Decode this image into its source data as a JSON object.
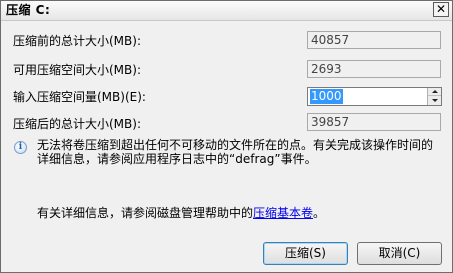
{
  "window": {
    "title": "压缩 C:",
    "close_glyph": "✕"
  },
  "fields": {
    "total_before": {
      "label": "压缩前的总计大小(MB):",
      "value": "40857"
    },
    "available": {
      "label": "可用压缩空间大小(MB):",
      "value": "2693"
    },
    "input": {
      "label": "输入压缩空间量(MB)(E):",
      "value": "1000"
    },
    "total_after": {
      "label": "压缩后的总计大小(MB):",
      "value": "39857"
    }
  },
  "info": {
    "icon": "info-icon",
    "text": "无法将卷压缩到超出任何不可移动的文件所在的点。有关完成该操作时间的详细信息，请参阅应用程序日志中的“defrag”事件。"
  },
  "help": {
    "prefix": "有关详细信息，请参阅磁盘管理帮助中的",
    "link": "压缩基本卷",
    "suffix": "。"
  },
  "buttons": {
    "shrink": "压缩(S)",
    "cancel": "取消(C)"
  }
}
